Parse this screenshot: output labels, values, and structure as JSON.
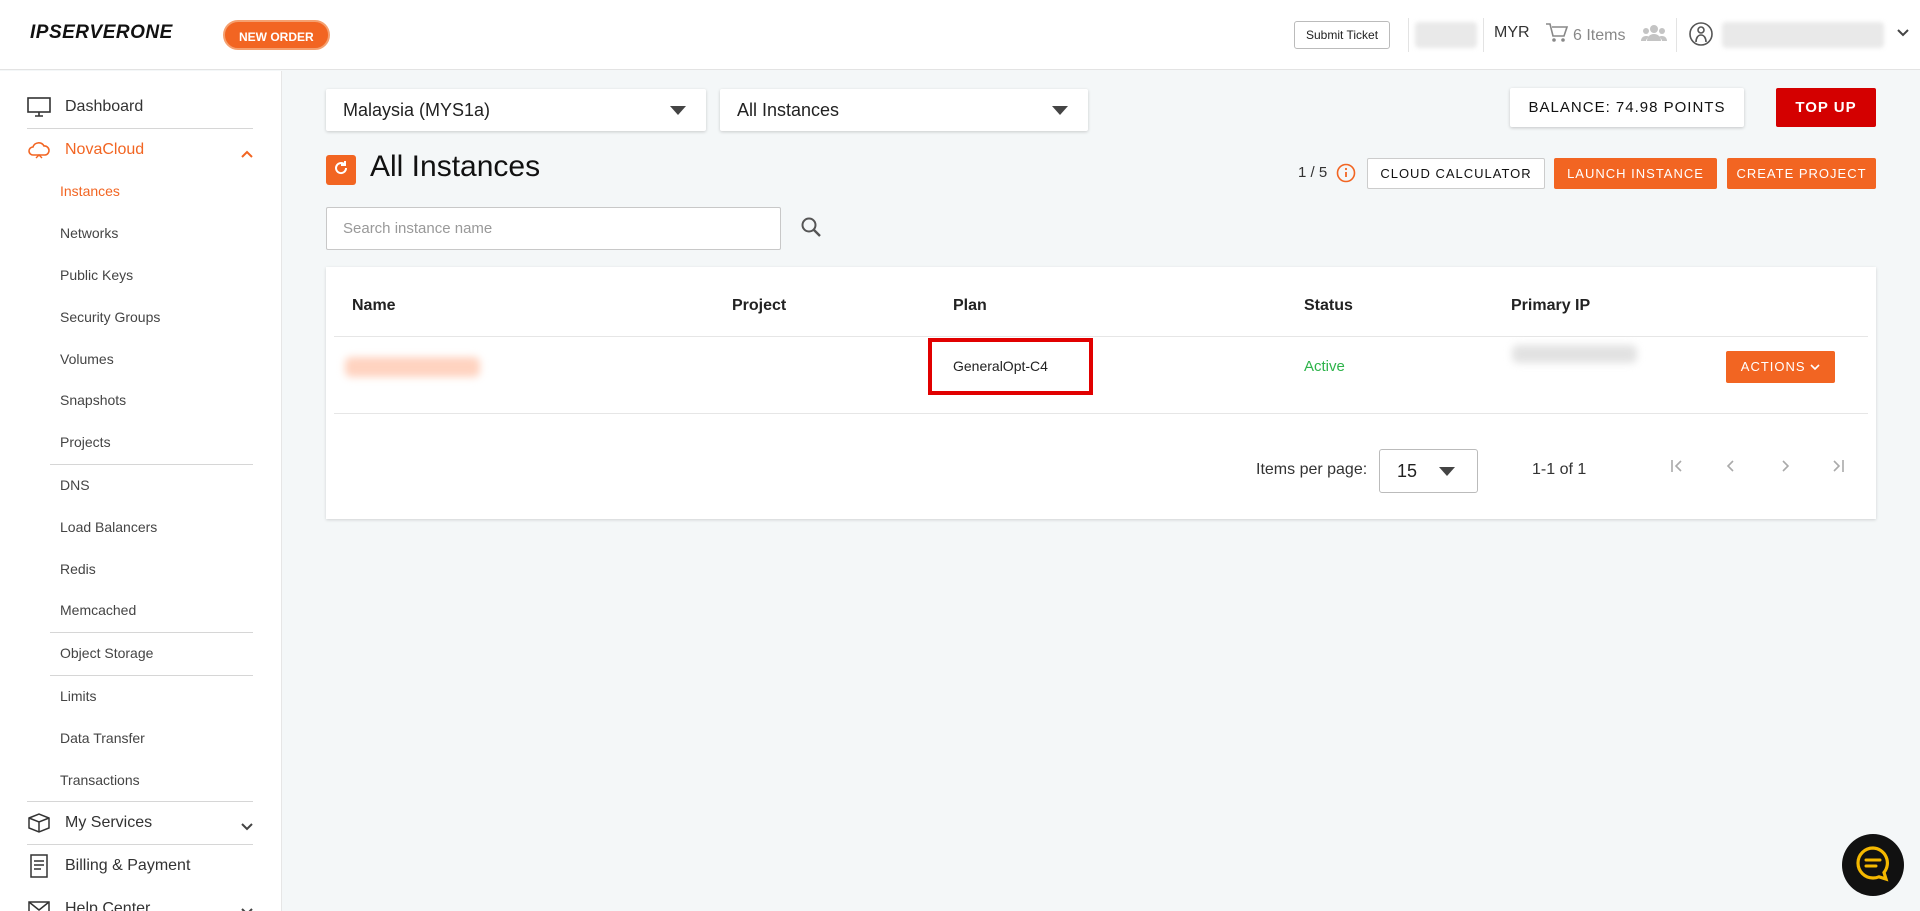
{
  "header": {
    "logo": "IPSERVERONE",
    "new_order": "NEW ORDER",
    "submit_ticket": "Submit Ticket",
    "currency": "MYR",
    "cart_label": "6 Items"
  },
  "sidebar": {
    "dashboard": "Dashboard",
    "novacloud": "NovaCloud",
    "sub_items": [
      "Instances",
      "Networks",
      "Public Keys",
      "Security Groups",
      "Volumes",
      "Snapshots",
      "Projects",
      "DNS",
      "Load Balancers",
      "Redis",
      "Memcached",
      "Object Storage",
      "Limits",
      "Data Transfer",
      "Transactions"
    ],
    "my_services": "My Services",
    "billing": "Billing & Payment",
    "help_center": "Help Center"
  },
  "filters": {
    "region": "Malaysia (MYS1a)",
    "scope": "All Instances"
  },
  "balance": "BALANCE: 74.98 POINTS",
  "topup": "TOP UP",
  "page_title": "All Instances",
  "quota": "1 / 5",
  "buttons": {
    "cloud_calculator": "CLOUD CALCULATOR",
    "launch_instance": "LAUNCH INSTANCE",
    "create_project": "CREATE PROJECT"
  },
  "search": {
    "placeholder": "Search instance name"
  },
  "table": {
    "headers": [
      "Name",
      "Project",
      "Plan",
      "Status",
      "Primary IP"
    ],
    "rows": [
      {
        "name": "",
        "project": "",
        "plan": "GeneralOpt-C4",
        "status": "Active",
        "ip": ""
      }
    ],
    "actions_label": "ACTIONS"
  },
  "pagination": {
    "items_per_page_label": "Items per page:",
    "items_per_page": "15",
    "range": "1-1 of 1"
  },
  "colors": {
    "accent": "#f26522",
    "topup": "#d40000",
    "active": "#2db34a",
    "highlight": "#e10000"
  }
}
